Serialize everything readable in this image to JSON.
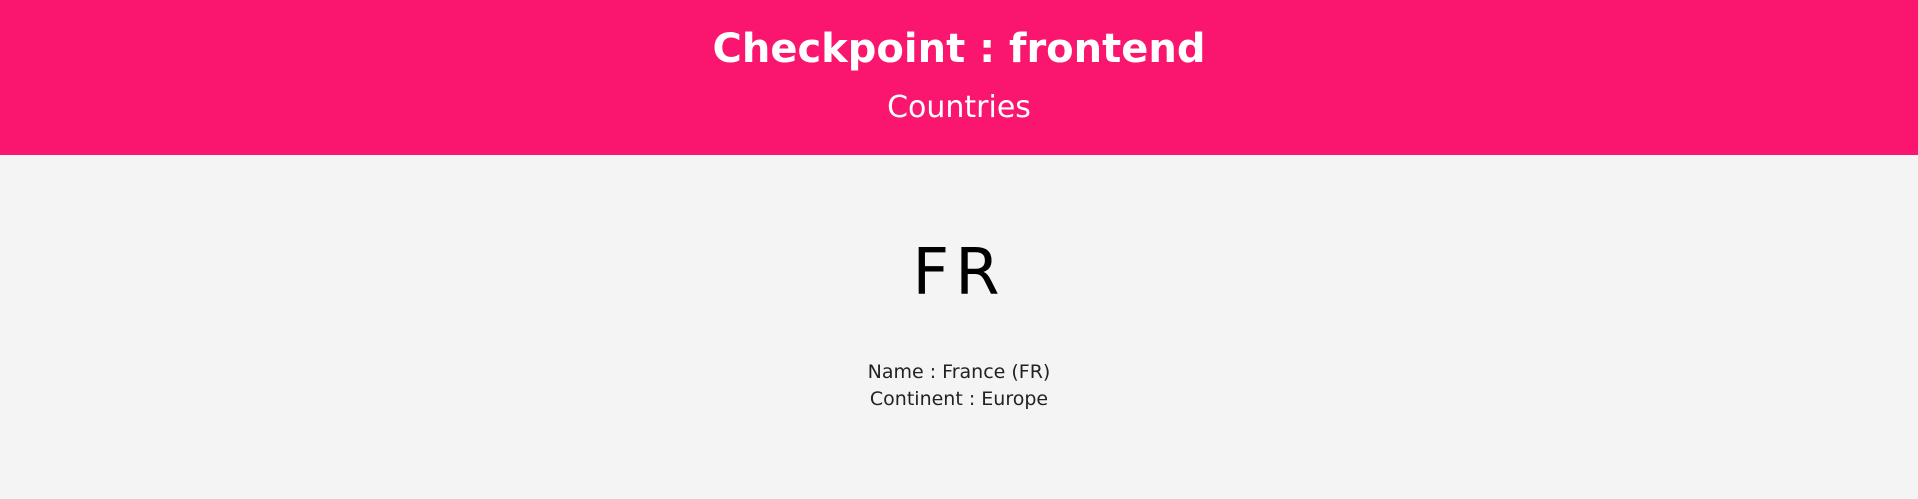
{
  "header": {
    "title": "Checkpoint : frontend",
    "nav_link": "Countries"
  },
  "country": {
    "code": "FR",
    "name_line": "Name : France (FR)",
    "continent_line": "Continent : Europe"
  },
  "colors": {
    "header_background": "#fa166e",
    "header_text": "#ffffff",
    "page_background": "#f4f4f4",
    "body_text": "#000000"
  }
}
